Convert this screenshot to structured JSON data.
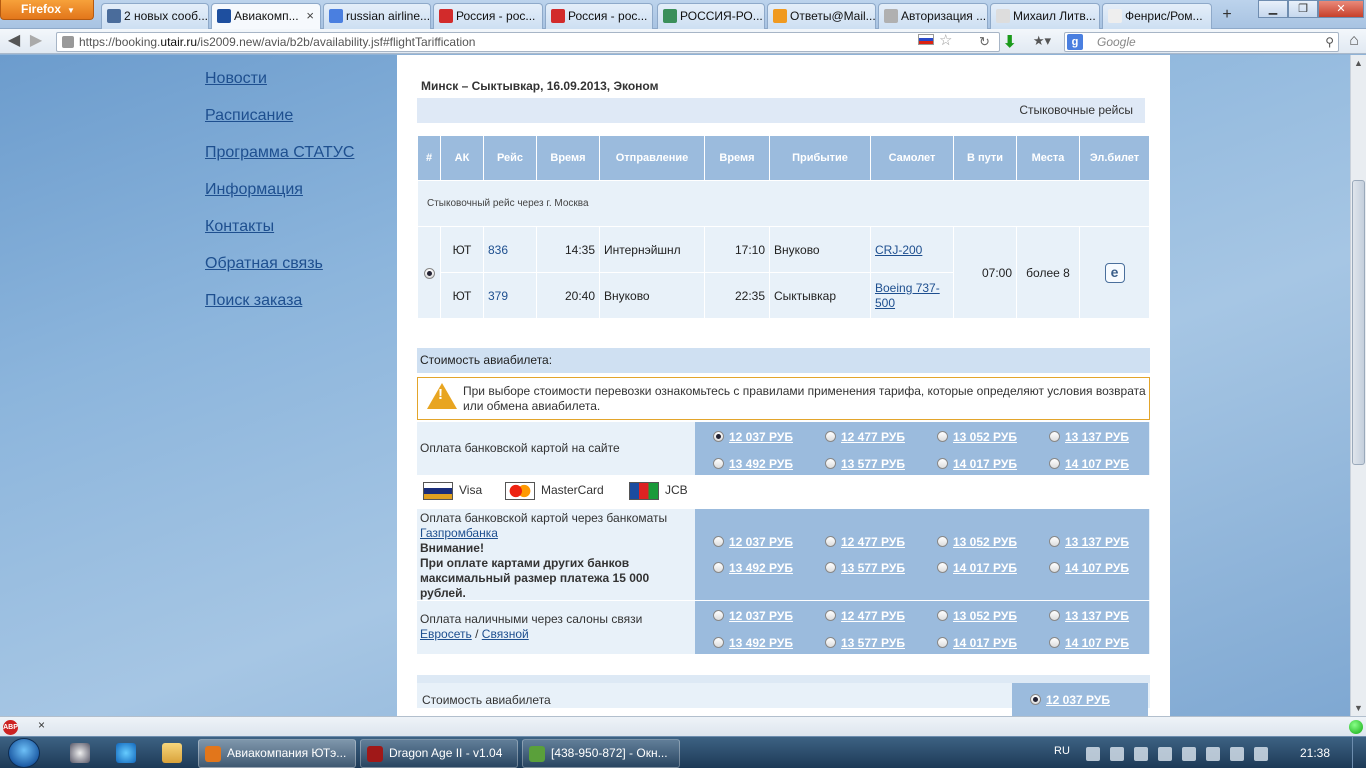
{
  "browser": {
    "firefox_label": "Firefox",
    "tabs": [
      {
        "label": "2 новых сооб...",
        "icon": "email-icon",
        "color": "#4a6c9b",
        "active": false
      },
      {
        "label": "Авиакомп...",
        "icon": "utair-logo-icon",
        "color": "#1e4f9f",
        "active": true
      },
      {
        "label": "russian airline...",
        "icon": "google-icon",
        "color": "#4a7fe0",
        "active": false
      },
      {
        "label": "Россия - рос...",
        "icon": "rossiya-icon",
        "color": "#d22b2b",
        "active": false
      },
      {
        "label": "Россия - рос...",
        "icon": "rossiya-icon",
        "color": "#d22b2b",
        "active": false
      },
      {
        "label": "РОССИЯ-РО...",
        "icon": "globe-icon",
        "color": "#3a8f5a",
        "active": false
      },
      {
        "label": "Ответы@Mail...",
        "icon": "mail-ru-icon",
        "color": "#f09a20",
        "active": false
      },
      {
        "label": "Авторизация ...",
        "icon": "warning-icon",
        "color": "#b0b0b0",
        "active": false
      },
      {
        "label": "Михаил Литв...",
        "icon": "page-icon",
        "color": "#dddddd",
        "active": false
      },
      {
        "label": "Фенрис/Ром...",
        "icon": "wikipedia-icon",
        "color": "#eeeeee",
        "active": false
      }
    ],
    "tab_close": "×",
    "new_tab": "+",
    "url_prefix": "https://booking.",
    "url_host": "utair.ru",
    "url_path": "/is2009.new/avia/b2b/availability.jsf#flightTariffication",
    "search_placeholder": "Google"
  },
  "sidebar": {
    "items": [
      "Новости",
      "Расписание",
      "Программа СТАТУС",
      "Информация",
      "Контакты",
      "Обратная связь",
      "Поиск заказа"
    ]
  },
  "content": {
    "route_header": "Минск – Сыктывкар, 16.09.2013, Эконом",
    "connecting_flights_label": "Стыковочные рейсы",
    "table": {
      "headers": [
        "#",
        "АК",
        "Рейс",
        "Время",
        "Отправление",
        "Время",
        "Прибытие",
        "Самолет",
        "В пути",
        "Места",
        "Эл.билет"
      ],
      "connection_note": "Стыковочный рейс через г. Москва",
      "segments": [
        {
          "airline": "ЮТ",
          "flight": "836",
          "dep_time": "14:35",
          "dep_airport": "Интернэйшнл",
          "arr_time": "17:10",
          "arr_airport": "Внуково",
          "aircraft": "CRJ-200"
        },
        {
          "airline": "ЮТ",
          "flight": "379",
          "dep_time": "20:40",
          "dep_airport": "Внуково",
          "arr_time": "22:35",
          "arr_airport": "Сыктывкар",
          "aircraft": "Boeing 737-500"
        }
      ],
      "travel_time": "07:00",
      "seats": "более 8",
      "eticket": "e"
    },
    "price_header": "Стоимость авиабилета:",
    "warning": "При выборе стоимости перевозки ознакомьтесь с правилами применения тарифа, которые определяют условия возврата или обмена авиабилета.",
    "prices": [
      "12 037 РУБ",
      "12 477 РУБ",
      "13 052 РУБ",
      "13 137 РУБ",
      "13 492 РУБ",
      "13 577 РУБ",
      "14 017 РУБ",
      "14 107 РУБ"
    ],
    "payment_card_online": "Оплата банковской картой на сайте",
    "card_types": [
      "Visa",
      "MasterCard",
      "JCB"
    ],
    "payment_atm_prefix": "Оплата банковской картой через банкоматы",
    "payment_atm_bank": "Газпромбанка",
    "payment_atm_warning_title": "Внимание!",
    "payment_atm_warning": "При оплате картами других банков максимальный размер платежа 15 000 рублей.",
    "payment_cash_prefix": "Оплата наличными через салоны связи",
    "payment_cash_link1": "Евросеть",
    "payment_cash_sep": "/",
    "payment_cash_link2": "Связной",
    "total_label": "Стоимость авиабилета",
    "total_value": "12 037 РУБ"
  },
  "addon_bar": {
    "abp_label": "ABP",
    "close": "×"
  },
  "taskbar": {
    "tasks": [
      {
        "label": "Авиакомпания ЮТэ...",
        "icon": "firefox-icon",
        "color": "#e2761b",
        "active": true
      },
      {
        "label": "Dragon Age II - v1.04",
        "icon": "dragon-age-icon",
        "color": "#a01818",
        "active": false
      },
      {
        "label": "[438-950-872] - Окн...",
        "icon": "chat-window-icon",
        "color": "#5aa03a",
        "active": false
      }
    ],
    "lang": "RU",
    "clock": "21:38"
  }
}
